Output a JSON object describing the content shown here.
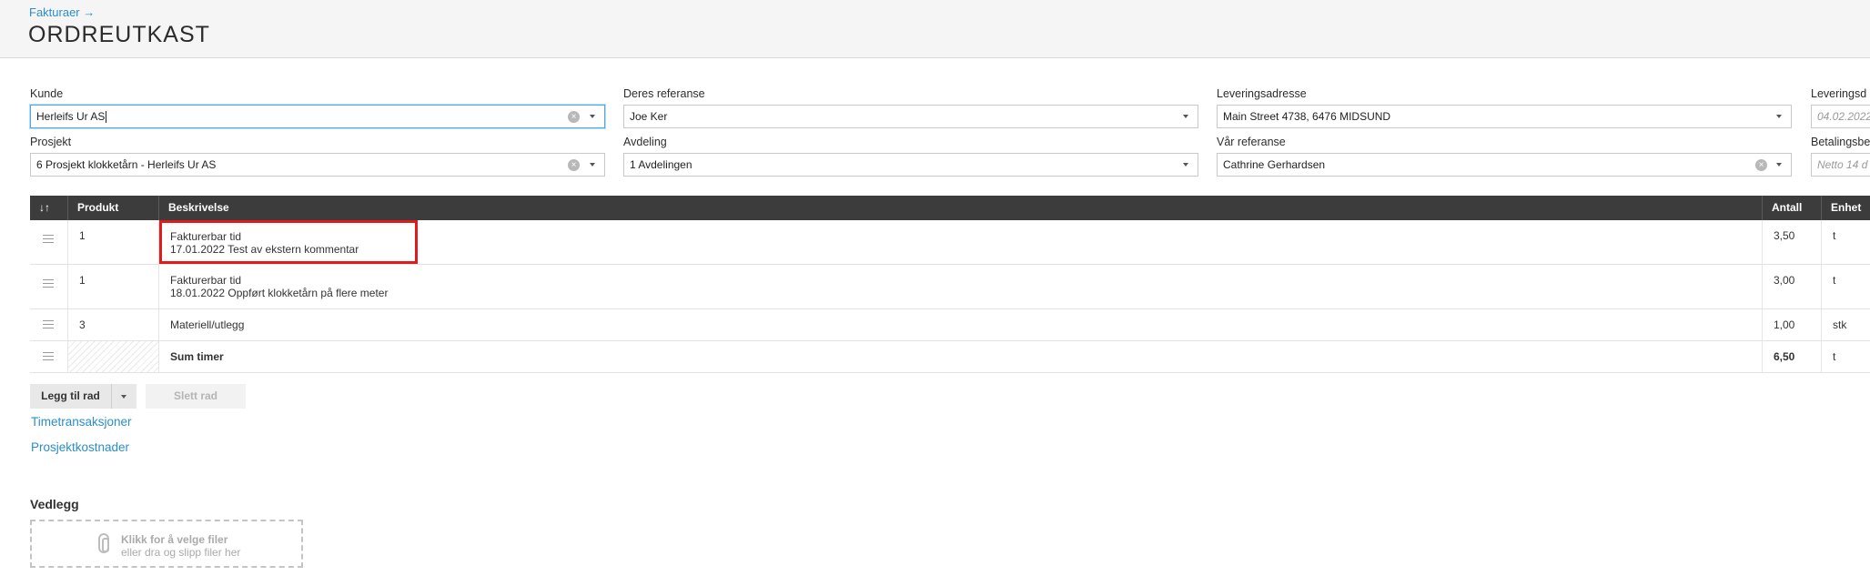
{
  "header": {
    "breadcrumb": "Fakturaer →",
    "title": "ORDREUTKAST"
  },
  "form": {
    "kunde": {
      "label": "Kunde",
      "value": "Herleifs Ur AS"
    },
    "prosjekt": {
      "label": "Prosjekt",
      "value": "6 Prosjekt klokketårn - Herleifs Ur AS"
    },
    "deres_referanse": {
      "label": "Deres referanse",
      "value": "Joe Ker"
    },
    "avdeling": {
      "label": "Avdeling",
      "value": "1 Avdelingen"
    },
    "leveringsadresse": {
      "label": "Leveringsadresse",
      "value": "Main Street 4738, 6476 MIDSUND"
    },
    "var_referanse": {
      "label": "Vår referanse",
      "value": "Cathrine Gerhardsen"
    },
    "leveringsdato": {
      "label": "Leveringsd",
      "placeholder": "04.02.2022"
    },
    "betalingsbet": {
      "label": "Betalingsbe",
      "placeholder": "Netto 14 d"
    }
  },
  "table": {
    "columns": {
      "sort": "↓↑",
      "produkt": "Produkt",
      "beskrivelse": "Beskrivelse",
      "antall": "Antall",
      "enhet": "Enhet"
    },
    "rows": [
      {
        "produkt": "1",
        "line1": "Fakturerbar tid",
        "line2": "17.01.2022 Test av ekstern kommentar",
        "antall": "3,50",
        "enhet": "t"
      },
      {
        "produkt": "1",
        "line1": "Fakturerbar tid",
        "line2": "18.01.2022 Oppført klokketårn på flere meter",
        "antall": "3,00",
        "enhet": "t"
      },
      {
        "produkt": "3",
        "line1": "Materiell/utlegg",
        "line2": "",
        "antall": "1,00",
        "enhet": "stk"
      }
    ],
    "sum": {
      "label": "Sum timer",
      "antall": "6,50",
      "enhet": "t"
    }
  },
  "actions": {
    "add_row": "Legg til rad",
    "delete_row": "Slett rad",
    "link_time": "Timetransaksjoner",
    "link_costs": "Prosjektkostnader"
  },
  "attachments": {
    "title": "Vedlegg",
    "drop_title": "Klikk for å velge filer",
    "drop_sub": "eller dra og slipp filer her"
  },
  "colors": {
    "accent": "#2a8ec9",
    "header_bg": "#3c3c3c",
    "highlight": "#e11b1b"
  }
}
